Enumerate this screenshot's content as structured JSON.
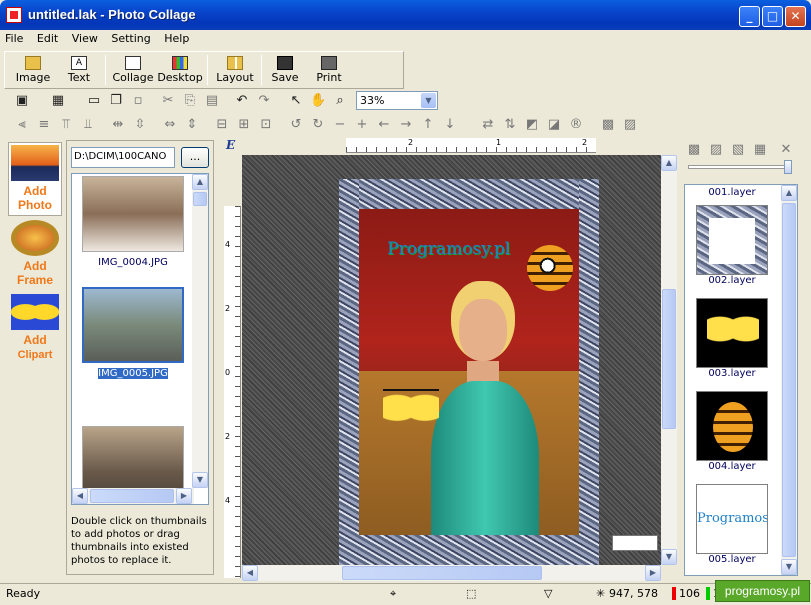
{
  "window": {
    "title": "untitled.lak - Photo Collage"
  },
  "menu": [
    "File",
    "Edit",
    "View",
    "Setting",
    "Help"
  ],
  "toolbar": {
    "image": "Image",
    "text": "Text",
    "collage": "Collage",
    "desktop": "Desktop",
    "layout": "Layout",
    "save": "Save",
    "print": "Print"
  },
  "zoom": {
    "value": "33%"
  },
  "left_tabs": {
    "add_photo": [
      "Add",
      "Photo"
    ],
    "add_frame": [
      "Add",
      "Frame"
    ],
    "add_clipart": [
      "Add",
      "Clipart"
    ]
  },
  "browser": {
    "path": "D:\\DCIM\\100CANO",
    "browse_label": "...",
    "files": [
      {
        "name": "IMG_0004.JPG",
        "selected": false
      },
      {
        "name": "IMG_0005.JPG",
        "selected": true
      },
      {
        "name": "",
        "selected": false
      }
    ],
    "help": "Double click on thumbnails to add photos or drag thumbnails into existed photos to replace it."
  },
  "canvas": {
    "watermark": "Programosy.pl",
    "hruler_ticks": [
      "2",
      "1",
      "2"
    ],
    "vruler_ticks": [
      "4",
      "2",
      "0",
      "2",
      "4"
    ]
  },
  "layers": [
    {
      "name": "001.layer"
    },
    {
      "name": "002.layer"
    },
    {
      "name": "003.layer"
    },
    {
      "name": "004.layer"
    },
    {
      "name": "005.layer",
      "text": "Programosy.pl"
    }
  ],
  "status": {
    "ready": "Ready",
    "coords": "947, 578",
    "r": "106",
    "g": "106",
    "b": "106"
  },
  "brand": "programosy.pl",
  "colors": {
    "accent": "#f07818",
    "selection": "#316ac5",
    "title_bar": "#0841c8"
  }
}
